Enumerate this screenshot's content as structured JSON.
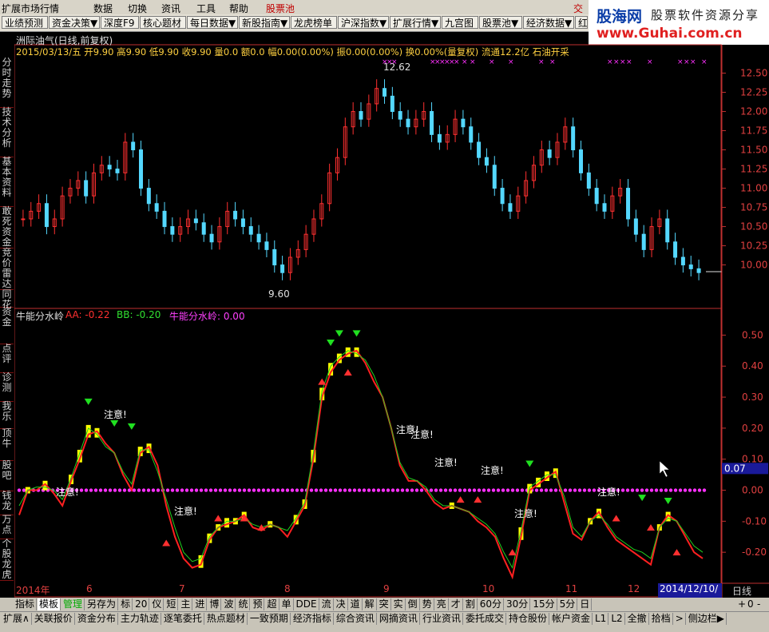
{
  "menu": [
    "扩展市场行情",
    "数据",
    "切换",
    "资讯",
    "工具",
    "帮助",
    "股票池"
  ],
  "menu_badge": "交",
  "toolbar": [
    "业绩预测",
    "资金决策▼",
    "深度F9",
    "核心题材",
    "每日数据▼",
    "新股指南▼",
    "龙虎榜单",
    "沪深指数▼",
    "扩展行情▼",
    "九宫图",
    "股票池▼",
    "经济数据▼",
    "红"
  ],
  "logo": {
    "title": "股海网",
    "slogan": "股票软件资源分享",
    "url": "www.Guhai.com.cn"
  },
  "left_tabs": [
    "分时走势",
    "技术分析",
    "基本资料",
    "敢死资金",
    "竞价雷达",
    "同花",
    "资金",
    "点评",
    "诊测",
    "我乐",
    "顶牛",
    "股吧",
    "钱龙",
    "万点",
    "个股龙虎"
  ],
  "stock": {
    "name": "洲际油气(日线,前复权)",
    "quote": "2015/03/13/五 开9.90 高9.90 低9.90 收9.90 量0.0 额0.0 幅0.00(0.00%) 振0.00(0.00%) 换0.00%(量复权) 流通12.2亿 石油开采",
    "high_label": "12.62",
    "low_label": "9.60"
  },
  "indicator": {
    "name": "牛能分水岭",
    "aa": "AA: -0.22",
    "bb": "BB: -0.20",
    "line": "牛能分水岭: 0.00",
    "note": "注意!"
  },
  "price_axis": [
    "12.50",
    "12.25",
    "12.00",
    "11.75",
    "11.50",
    "11.25",
    "11.00",
    "10.75",
    "10.50",
    "10.25",
    "10.00"
  ],
  "ind_axis": [
    "0.50",
    "0.40",
    "0.30",
    "0.20",
    "0.10",
    "0.07",
    "0.00",
    "-0.10",
    "-0.20"
  ],
  "x_axis": [
    "2014年",
    "6",
    "7",
    "8",
    "9",
    "10",
    "11",
    "12",
    "2014/12/10/三"
  ],
  "period": "日线",
  "right_small": [
    "+",
    "0",
    "-"
  ],
  "tabs_row1": [
    "指标",
    "模板",
    "管理",
    "另存为",
    "标",
    "20",
    "仪",
    "短",
    "主",
    "进",
    "博",
    "波",
    "统",
    "预",
    "超",
    "单",
    "DDE",
    "流",
    "决",
    "道",
    "解",
    "突",
    "实",
    "倒",
    "势",
    "亮",
    "才",
    "割",
    "60分",
    "30分",
    "15分",
    "5分",
    "日"
  ],
  "tabs_row2": [
    "扩展∧",
    "关联报价",
    "资金分布",
    "主力轨迹",
    "逐笔委托",
    "热点题材",
    "一致预期",
    "经济指标",
    "综合资讯",
    "网摘资讯",
    "行业资讯",
    "委托成交",
    "持仓股份",
    "帐户资金",
    "L1",
    "L2",
    "全撤",
    "拾档",
    ">",
    "侧边栏▶"
  ],
  "colors": {
    "up": "#ff3030",
    "down": "#54d8ff",
    "aa": "#ff2020",
    "bb": "#20d020",
    "dots": "#ff30ff",
    "bar": "#ffff00",
    "axis": "#c03030"
  },
  "chart_data": [
    {
      "type": "candlestick",
      "title": "洲际油气(日线,前复权)",
      "ylim": [
        9.6,
        12.62
      ],
      "ticks": [
        12.5,
        12.25,
        12.0,
        11.75,
        11.5,
        11.25,
        11.0,
        10.75,
        10.5,
        10.25,
        10.0
      ],
      "closes": [
        10.6,
        10.7,
        10.8,
        10.5,
        10.6,
        10.9,
        11.0,
        11.1,
        10.9,
        11.2,
        11.3,
        11.25,
        11.2,
        11.6,
        11.5,
        11.0,
        10.8,
        10.7,
        10.5,
        10.4,
        10.5,
        10.6,
        10.55,
        10.4,
        10.3,
        10.5,
        10.7,
        10.6,
        10.5,
        10.4,
        10.3,
        10.2,
        10.0,
        9.9,
        10.1,
        10.2,
        10.4,
        10.6,
        10.8,
        11.2,
        11.4,
        11.8,
        12.0,
        11.9,
        12.1,
        12.3,
        12.2,
        12.0,
        11.9,
        11.8,
        11.9,
        12.0,
        11.7,
        11.6,
        11.7,
        11.9,
        11.8,
        11.6,
        11.4,
        11.3,
        11.0,
        10.8,
        10.7,
        10.9,
        11.1,
        11.3,
        11.5,
        11.4,
        11.6,
        11.8,
        11.5,
        11.2,
        11.0,
        10.8,
        10.7,
        10.9,
        11.0,
        10.6,
        10.4,
        10.2,
        10.5,
        10.6,
        10.3,
        10.1,
        10.0,
        9.95,
        9.9
      ]
    },
    {
      "type": "line",
      "title": "牛能分水岭",
      "ylim": [
        -0.3,
        0.55
      ],
      "series": [
        {
          "name": "AA",
          "values": [
            -0.08,
            0.0,
            0.0,
            0.02,
            -0.01,
            -0.05,
            0.03,
            0.1,
            0.18,
            0.19,
            0.15,
            0.12,
            0.05,
            0.0,
            0.12,
            0.14,
            0.08,
            -0.05,
            -0.15,
            -0.22,
            -0.25,
            -0.24,
            -0.16,
            -0.12,
            -0.11,
            -0.1,
            -0.08,
            -0.12,
            -0.13,
            -0.11,
            -0.12,
            -0.15,
            -0.1,
            -0.05,
            0.1,
            0.3,
            0.38,
            0.42,
            0.44,
            0.45,
            0.41,
            0.35,
            0.3,
            0.2,
            0.08,
            0.03,
            0.03,
            0.0,
            -0.04,
            -0.06,
            -0.05,
            -0.06,
            -0.07,
            -0.1,
            -0.12,
            -0.15,
            -0.22,
            -0.28,
            -0.15,
            0.0,
            0.02,
            0.04,
            0.06,
            -0.04,
            -0.14,
            -0.16,
            -0.1,
            -0.07,
            -0.12,
            -0.16,
            -0.18,
            -0.2,
            -0.22,
            -0.24,
            -0.12,
            -0.08,
            -0.1,
            -0.15,
            -0.2,
            -0.22
          ]
        },
        {
          "name": "BB",
          "values": [
            -0.05,
            0.0,
            0.01,
            0.01,
            0.0,
            -0.03,
            0.04,
            0.12,
            0.2,
            0.18,
            0.14,
            0.12,
            0.06,
            0.02,
            0.13,
            0.13,
            0.06,
            -0.03,
            -0.12,
            -0.2,
            -0.23,
            -0.22,
            -0.15,
            -0.12,
            -0.1,
            -0.1,
            -0.09,
            -0.11,
            -0.12,
            -0.11,
            -0.12,
            -0.13,
            -0.09,
            -0.04,
            0.12,
            0.32,
            0.4,
            0.43,
            0.45,
            0.44,
            0.42,
            0.37,
            0.3,
            0.2,
            0.09,
            0.04,
            0.03,
            0.01,
            -0.03,
            -0.05,
            -0.05,
            -0.06,
            -0.07,
            -0.09,
            -0.11,
            -0.14,
            -0.2,
            -0.25,
            -0.13,
            0.01,
            0.03,
            0.05,
            0.05,
            -0.02,
            -0.12,
            -0.15,
            -0.1,
            -0.08,
            -0.11,
            -0.15,
            -0.17,
            -0.19,
            -0.2,
            -0.22,
            -0.12,
            -0.09,
            -0.1,
            -0.14,
            -0.18,
            -0.2
          ]
        },
        {
          "name": "牛能分水岭",
          "values": [
            0.0
          ]
        }
      ]
    }
  ]
}
